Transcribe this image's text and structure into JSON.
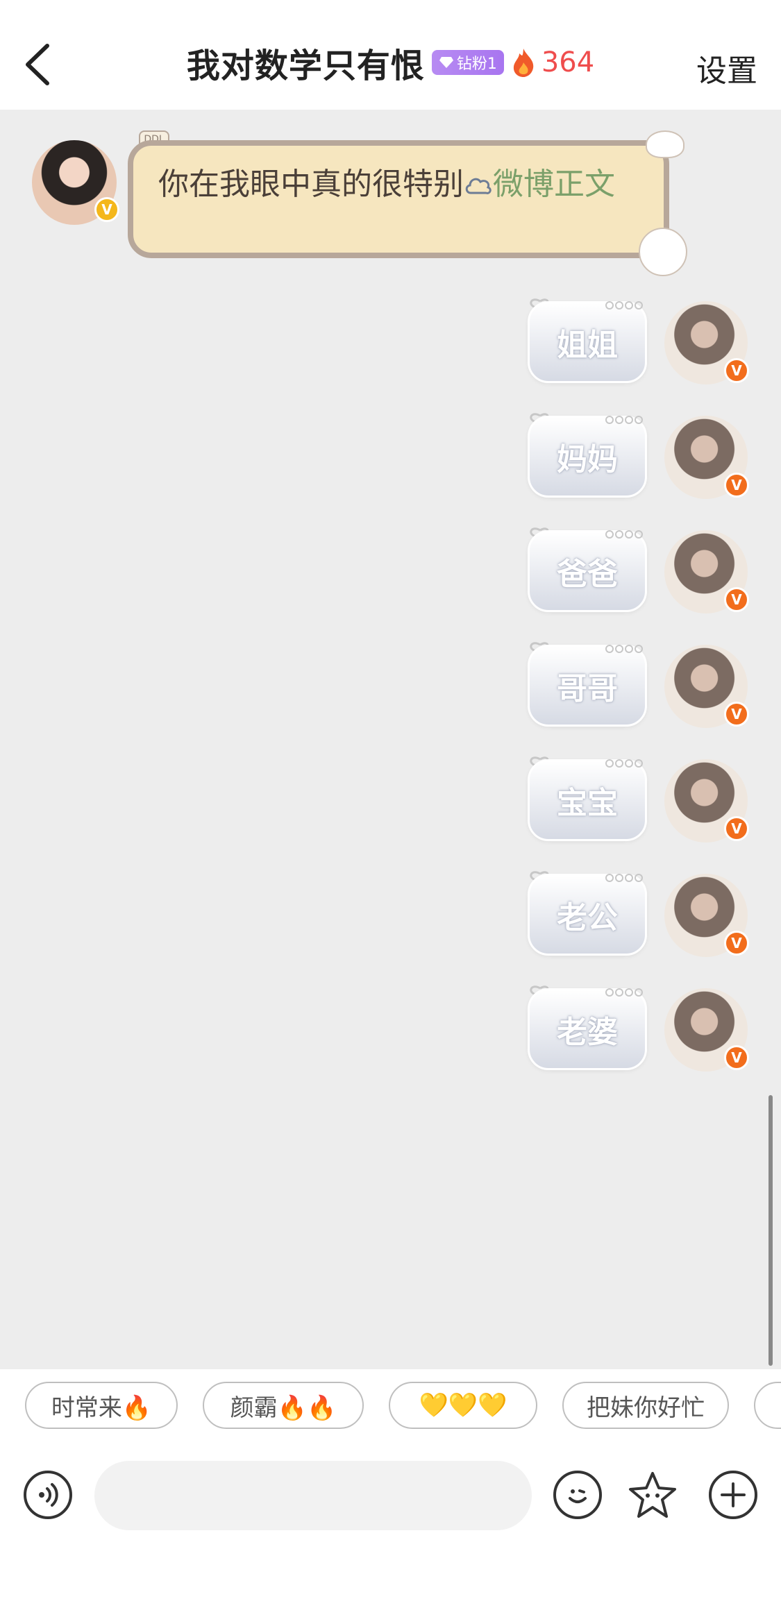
{
  "header": {
    "title": "我对数学只有恨",
    "fan_badge": "钻粉1",
    "flame_count": "364",
    "settings_label": "设置"
  },
  "chat": {
    "incoming": {
      "text": "你在我眼中真的很特别",
      "link_text": "微博正文",
      "deco_tag": "DDL"
    },
    "outgoing": [
      {
        "text": "姐姐"
      },
      {
        "text": "妈妈"
      },
      {
        "text": "爸爸"
      },
      {
        "text": "哥哥"
      },
      {
        "text": "宝宝"
      },
      {
        "text": "老公"
      },
      {
        "text": "老婆"
      }
    ],
    "verify_mark": "V"
  },
  "quick_replies": [
    {
      "label": "时常来🔥"
    },
    {
      "label": "颜霸🔥🔥"
    },
    {
      "label": "💛💛💛"
    },
    {
      "label": "把妹你好忙"
    }
  ],
  "input": {
    "placeholder": ""
  },
  "colors": {
    "flame": "#ef4d4d",
    "badge": "#a875f0",
    "link": "#7ba06a",
    "verify_orange": "#f26d1c",
    "verify_gold": "#f4b71b"
  }
}
